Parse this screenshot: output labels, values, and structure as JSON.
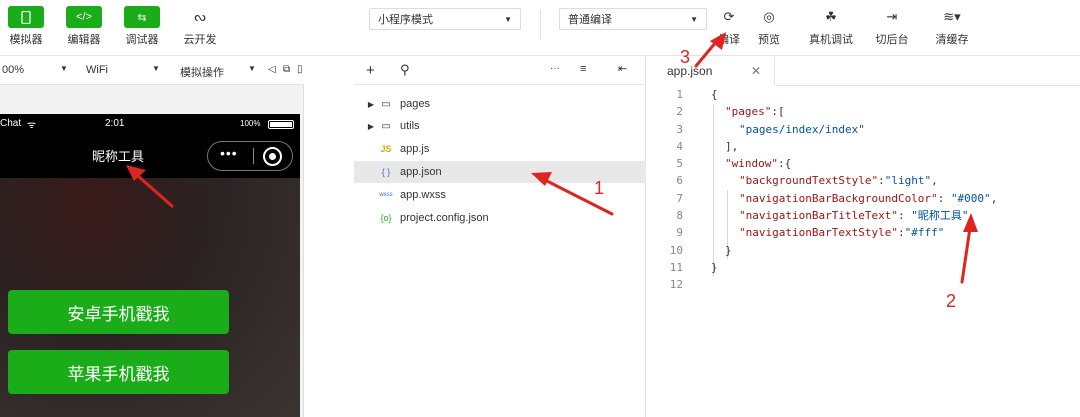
{
  "toolbar": {
    "buttons": [
      {
        "label": "模拟器",
        "icon": "phone-icon"
      },
      {
        "label": "编辑器",
        "icon": "code-icon"
      },
      {
        "label": "调试器",
        "icon": "debug-icon"
      },
      {
        "label": "云开发",
        "icon": "cloud-icon"
      }
    ],
    "mode_select": "小程序模式",
    "compile_select": "普通编译",
    "actions": [
      {
        "label": "编译",
        "icon": "refresh-icon"
      },
      {
        "label": "预览",
        "icon": "eye-icon"
      },
      {
        "label": "真机调试",
        "icon": "bug-icon"
      },
      {
        "label": "切后台",
        "icon": "switch-icon"
      },
      {
        "label": "清缓存",
        "icon": "layers-icon"
      }
    ]
  },
  "simulator": {
    "zoom": "00%",
    "network": "WiFi",
    "operation": "模拟操作",
    "status": {
      "carrier": "Chat",
      "time": "2:01",
      "battery": "100%"
    },
    "nav_title": "昵称工具",
    "buttons": [
      "安卓手机戳我",
      "苹果手机戳我"
    ]
  },
  "filetree": {
    "items": [
      {
        "name": "pages",
        "type": "folder"
      },
      {
        "name": "utils",
        "type": "folder"
      },
      {
        "name": "app.js",
        "type": "js"
      },
      {
        "name": "app.json",
        "type": "json",
        "selected": true
      },
      {
        "name": "app.wxss",
        "type": "wxss"
      },
      {
        "name": "project.config.json",
        "type": "config"
      }
    ],
    "icon_labels": {
      "js": "JS",
      "json": "{ }",
      "wxss": "wxss",
      "config": "{o}"
    }
  },
  "editor": {
    "tab": "app.json",
    "line_numbers": [
      "1",
      "2",
      "3",
      "4",
      "5",
      "6",
      "7",
      "8",
      "9",
      "10",
      "11",
      "12"
    ],
    "code": {
      "l1": "{",
      "l2_key": "\"pages\"",
      "l2_rest": ":[",
      "l3": "\"pages/index/index\"",
      "l4": "],",
      "l5_key": "\"window\"",
      "l5_rest": ":{",
      "l6_key": "\"backgroundTextStyle\"",
      "l6_val": "\"light\"",
      "l7_key": "\"navigationBarBackgroundColor\"",
      "l7_val": "\"#000\"",
      "l8_key": "\"navigationBarTitleText\"",
      "l8_val": "\"昵称工具\"",
      "l9_key": "\"navigationBarTextStyle\"",
      "l9_val": "\"#fff\"",
      "l10": "}",
      "l11": "}"
    }
  },
  "annotations": {
    "one": "1",
    "two": "2",
    "three": "3"
  },
  "colors": {
    "accent": "#1aad19",
    "annotation": "#e0241f"
  }
}
